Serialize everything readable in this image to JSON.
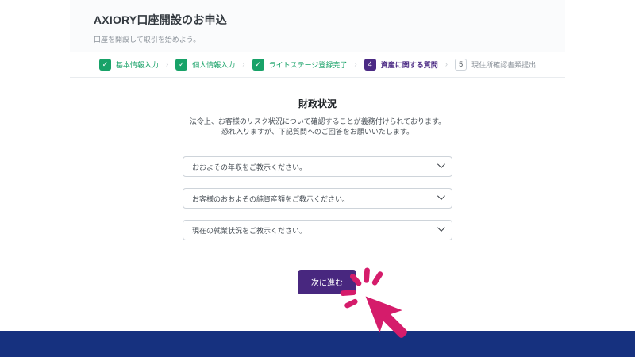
{
  "header": {
    "title": "AXIORY口座開設のお申込",
    "subtitle": "口座を開設して取引を始めよう。"
  },
  "stepper": {
    "separator": "›",
    "steps": [
      {
        "marker": "✓",
        "label": "基本情報入力",
        "state": "done"
      },
      {
        "marker": "✓",
        "label": "個人情報入力",
        "state": "done"
      },
      {
        "marker": "✓",
        "label": "ライトステージ登録完了",
        "state": "done"
      },
      {
        "marker": "4",
        "label": "資産に関する質問",
        "state": "current"
      },
      {
        "marker": "5",
        "label": "現住所確認書類提出",
        "state": "upcoming"
      }
    ]
  },
  "form": {
    "section_title": "財政状況",
    "description_line1": "法令上、お客様のリスク状況について確認することが義務付けられております。",
    "description_line2": "恐れ入りますが、下記質問へのご回答をお願いいたします。",
    "selects": [
      {
        "placeholder": "おおよその年収をご教示ください。"
      },
      {
        "placeholder": "お客様のおおよその純資産額をご教示ください。"
      },
      {
        "placeholder": "現在の就業状況をご教示ください。"
      }
    ],
    "next_button_label": "次に進む"
  },
  "icons": {
    "check_icon": "✓",
    "chevron_down_icon": "chevron-down",
    "cursor_click_icon": "mouse-cursor-click"
  },
  "colors": {
    "success_green": "#18a268",
    "accent_purple": "#48277f",
    "step_purple": "#4b2a84",
    "cursor_pink": "#d51c6b",
    "footer_navy": "#16317f",
    "header_band": "#fafbfc",
    "border_gray": "#ced4da"
  }
}
